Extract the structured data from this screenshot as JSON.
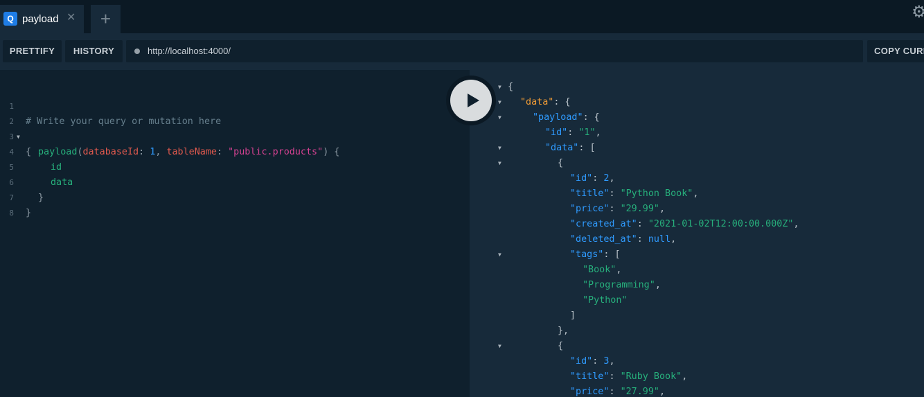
{
  "tab": {
    "icon_letter": "Q",
    "label": "payload",
    "close_glyph": "✕"
  },
  "new_tab_glyph": "+",
  "settings_glyph": "⚙",
  "toolbar": {
    "prettify_label": "PRETTIFY",
    "history_label": "HISTORY",
    "url": "http://localhost:4000/",
    "copy_label": "COPY CURL"
  },
  "editor": {
    "line_numbers": [
      "1",
      "2",
      "3",
      "4",
      "5",
      "6",
      "7",
      "8"
    ],
    "comment": "# Write your query or mutation here",
    "open_brace": "{",
    "query_field": "payload",
    "paren_open": "(",
    "arg1_name": "databaseId",
    "colon": ": ",
    "arg1_value": "1",
    "comma": ", ",
    "arg2_name": "tableName",
    "arg2_value": "\"public.products\"",
    "paren_close": ")",
    "brace_open_inline": " {",
    "field_id": "id",
    "field_data": "data",
    "inner_close": "}",
    "outer_close": "}"
  },
  "result": {
    "lines": [
      [
        "{"
      ],
      [
        "\"data\"",
        ": {"
      ],
      [
        "\"payload\"",
        ": {"
      ],
      [
        "\"id\"",
        ": ",
        "\"1\"",
        ","
      ],
      [
        "\"data\"",
        ": ["
      ],
      [
        "{"
      ],
      [
        "\"id\"",
        ": ",
        "2",
        ","
      ],
      [
        "\"title\"",
        ": ",
        "\"Python Book\"",
        ","
      ],
      [
        "\"price\"",
        ": ",
        "\"29.99\"",
        ","
      ],
      [
        "\"created_at\"",
        ": ",
        "\"2021-01-02T12:00:00.000Z\"",
        ","
      ],
      [
        "\"deleted_at\"",
        ": ",
        "null",
        ","
      ],
      [
        "\"tags\"",
        ": ["
      ],
      [
        "\"Book\"",
        ","
      ],
      [
        "\"Programming\"",
        ","
      ],
      [
        "\"Python\""
      ],
      [
        "]"
      ],
      [
        "},"
      ],
      [
        "{"
      ],
      [
        "\"id\"",
        ": ",
        "3",
        ","
      ],
      [
        "\"title\"",
        ": ",
        "\"Ruby Book\"",
        ","
      ],
      [
        "\"price\"",
        ": ",
        "\"27.99\"",
        ","
      ]
    ]
  },
  "run_button_label": "run-query"
}
